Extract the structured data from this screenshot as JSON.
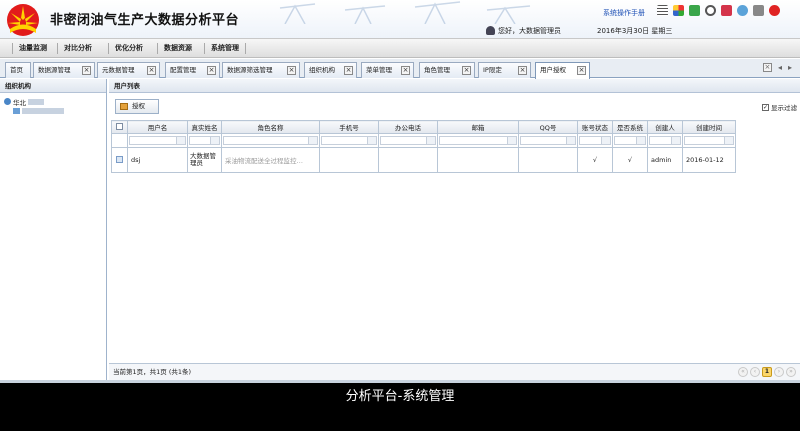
{
  "header": {
    "title": "非密闭油气生产大数据分析平台",
    "manual_link": "系统操作手册",
    "user_greeting": "您好，大数据管理员",
    "date": "2016年3月30日 星期三"
  },
  "menu": [
    "油量监测",
    "对比分析",
    "优化分析",
    "数据资源",
    "系统管理"
  ],
  "tabs": [
    {
      "label": "首页",
      "closable": false
    },
    {
      "label": "数据源管理",
      "closable": true
    },
    {
      "label": "元数据管理",
      "closable": true
    },
    {
      "label": "配置管理",
      "closable": true
    },
    {
      "label": "数据源筛选管理",
      "closable": true
    },
    {
      "label": "组织机构",
      "closable": true
    },
    {
      "label": "菜单管理",
      "closable": true
    },
    {
      "label": "角色管理",
      "closable": true
    },
    {
      "label": "IP限定",
      "closable": true
    },
    {
      "label": "用户授权",
      "closable": true,
      "active": true
    }
  ],
  "sidebar": {
    "title": "组织机构",
    "root_label": "华北",
    "child_label": ""
  },
  "panel": {
    "title": "用户列表",
    "authorize_button": "授权",
    "filter_checkbox_label": "显示过滤",
    "filter_checked": true
  },
  "table": {
    "columns": [
      "用户名",
      "真实姓名",
      "角色名称",
      "手机号",
      "办公电话",
      "邮箱",
      "QQ号",
      "账号状态",
      "是否系统",
      "创建人",
      "创建时间"
    ],
    "rows": [
      {
        "username": "dsj",
        "realname": "大数据管理员",
        "role": "采油物流配送全过程监控…",
        "mobile": "",
        "office_phone": "",
        "email": "",
        "qq": "",
        "status": "√",
        "is_system": "√",
        "creator": "admin",
        "created": "2016-01-12"
      }
    ]
  },
  "footer": {
    "page_info": "当前第1页，共1页 (共1条)",
    "current_page": "1"
  },
  "caption": "分析平台-系统管理"
}
